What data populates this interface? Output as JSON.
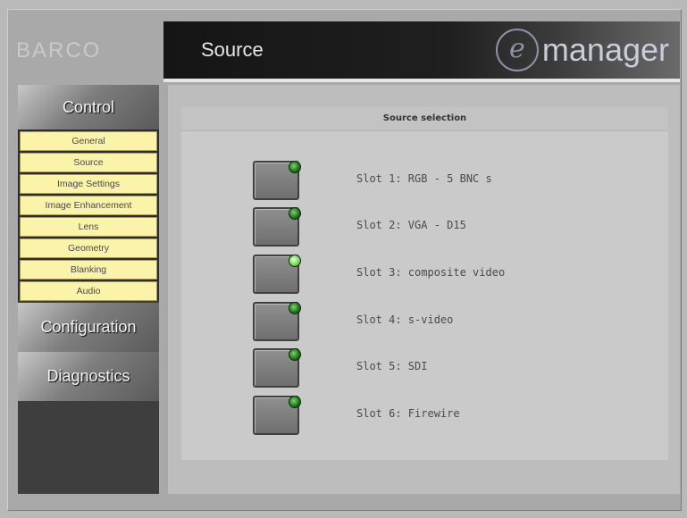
{
  "brand": {
    "logo": "BARCO",
    "product": "manager",
    "product_prefix": "e"
  },
  "header": {
    "title": "Source"
  },
  "sidebar": {
    "sections": [
      {
        "label": "Control"
      },
      {
        "label": "Configuration"
      },
      {
        "label": "Diagnostics"
      }
    ],
    "control_items": [
      {
        "label": "General"
      },
      {
        "label": "Source"
      },
      {
        "label": "Image Settings"
      },
      {
        "label": "Image Enhancement"
      },
      {
        "label": "Lens"
      },
      {
        "label": "Geometry"
      },
      {
        "label": "Blanking"
      },
      {
        "label": "Audio"
      }
    ]
  },
  "panel": {
    "title": "Source selection",
    "slots": [
      {
        "label": "Slot 1: RGB - 5 BNC s",
        "active": false
      },
      {
        "label": "Slot 2: VGA - D15",
        "active": false
      },
      {
        "label": "Slot 3: composite video",
        "active": true
      },
      {
        "label": "Slot 4: s-video",
        "active": false
      },
      {
        "label": "Slot 5: SDI",
        "active": false
      },
      {
        "label": "Slot 6: Firewire",
        "active": false
      }
    ]
  },
  "colors": {
    "nav_item_bg": "#fbf3a9",
    "header_bg": "#151515",
    "led_active": "#78d95f",
    "led_idle": "#1f6d1b"
  }
}
